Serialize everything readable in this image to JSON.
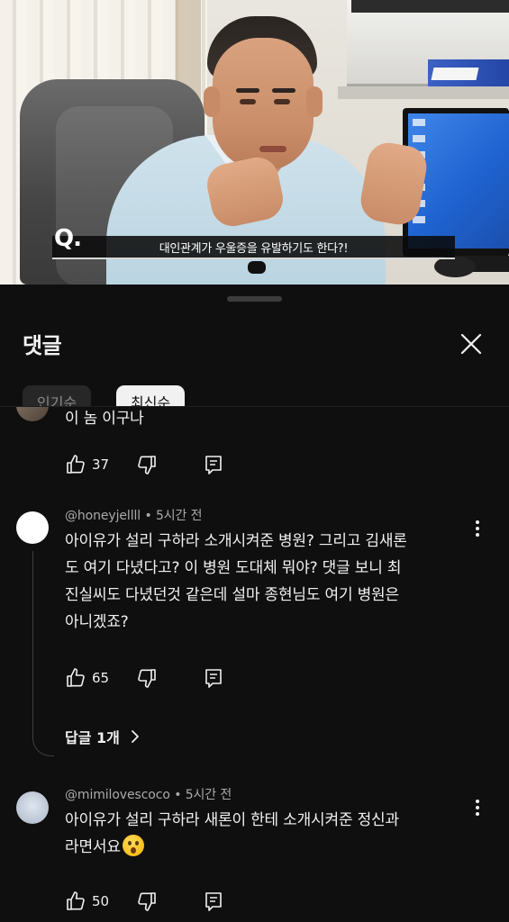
{
  "video": {
    "caption_marker": "Q.",
    "caption_text": "대인관계가 우울증을 유발하기도 한다?!"
  },
  "comments_panel": {
    "title": "댓글",
    "close_icon": "close-icon",
    "chips": [
      "인기순",
      "최신순"
    ],
    "selected_chip": "최신순"
  },
  "comments": [
    {
      "author": "",
      "time": "",
      "text": "이 놈 이구나",
      "likes": "37"
    },
    {
      "author": "@honeyjellll",
      "time": "5시간 전",
      "text_lines": [
        "아이유가 설리 구하라 소개시켜준 병원? 그리고 김새론",
        "도 여기 다녔다고? 이 병원 도대체 뭐야? 댓글 보니 최",
        "진실씨도 다녔던것 같은데 설마 종현님도 여기 병원은",
        "아니겠죠?"
      ],
      "likes": "65",
      "replies": "답글 1개"
    },
    {
      "author": "@mimilovescoco",
      "time": "5시간 전",
      "text_lines": [
        "아이유가 설리 구하라 새론이 한테 소개시켜준 정신과",
        "라면서요"
      ],
      "emoji": "hushed-face-emoji",
      "likes": "50"
    }
  ],
  "colors": {
    "background": "#0f0f0f",
    "text_primary": "#f1f1f1",
    "text_secondary": "#aaaaaa",
    "chip_selected_bg": "#f1f1f1",
    "chip_bg": "#272727"
  }
}
